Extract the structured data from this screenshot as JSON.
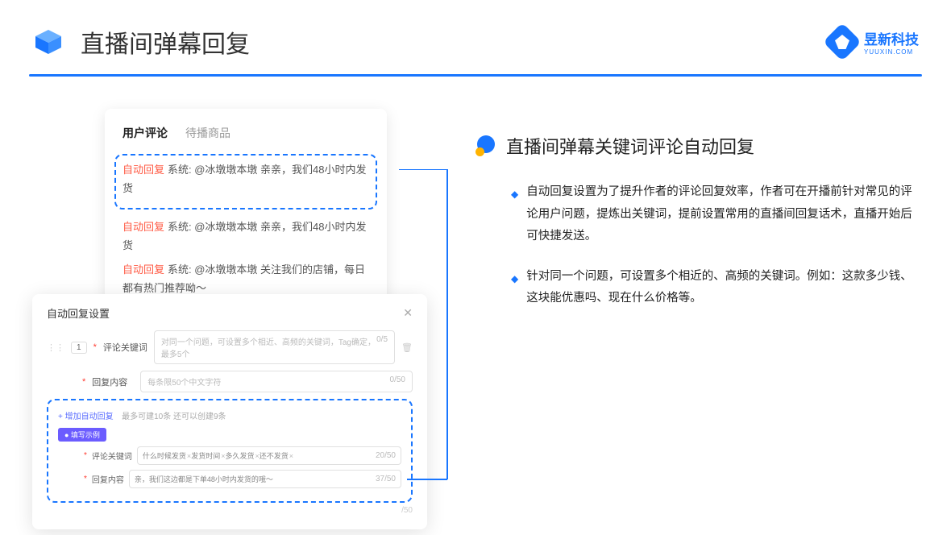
{
  "header": {
    "title": "直播间弹幕回复",
    "brand_name": "昱新科技",
    "brand_sub": "YUUXIN.COM"
  },
  "card1": {
    "tab_active": "用户评论",
    "tab_inactive": "待播商品",
    "auto_tag": "自动回复",
    "highlighted": "系统: @冰墩墩本墩 亲亲，我们48小时内发货",
    "line2": "系统: @冰墩墩本墩 亲亲，我们48小时内发货",
    "line3": "系统: @冰墩墩本墩 关注我们的店铺，每日都有热门推荐呦～"
  },
  "card2": {
    "title": "自动回复设置",
    "num": "1",
    "label_keyword": "评论关键词",
    "placeholder_keyword": "对同一个问题，可设置多个相近、高频的关键词，Tag确定，最多5个",
    "counter_kw": "0/5",
    "label_content": "回复内容",
    "placeholder_content": "每条限50个中文字符",
    "counter_content": "0/50",
    "add_link": "+ 增加自动回复",
    "add_note": "最多可建10条 还可以创建9条",
    "example_badge": "● 填写示例",
    "ex_label_kw": "评论关键词",
    "ex_tags": [
      "什么时候发货",
      "发货时间",
      "多久发货",
      "还不发货"
    ],
    "ex_counter_kw": "20/50",
    "ex_label_content": "回复内容",
    "ex_content": "亲，我们这边都是下单48小时内发货的哦～",
    "ex_counter_content": "37/50",
    "outside_counter": "/50"
  },
  "right": {
    "section_title": "直播间弹幕关键词评论自动回复",
    "bullet1": "自动回复设置为了提升作者的评论回复效率，作者可在开播前针对常见的评论用户问题，提炼出关键词，提前设置常用的直播间回复话术，直播开始后可快捷发送。",
    "bullet2": "针对同一个问题，可设置多个相近的、高频的关键词。例如：这款多少钱、这块能优惠吗、现在什么价格等。"
  }
}
